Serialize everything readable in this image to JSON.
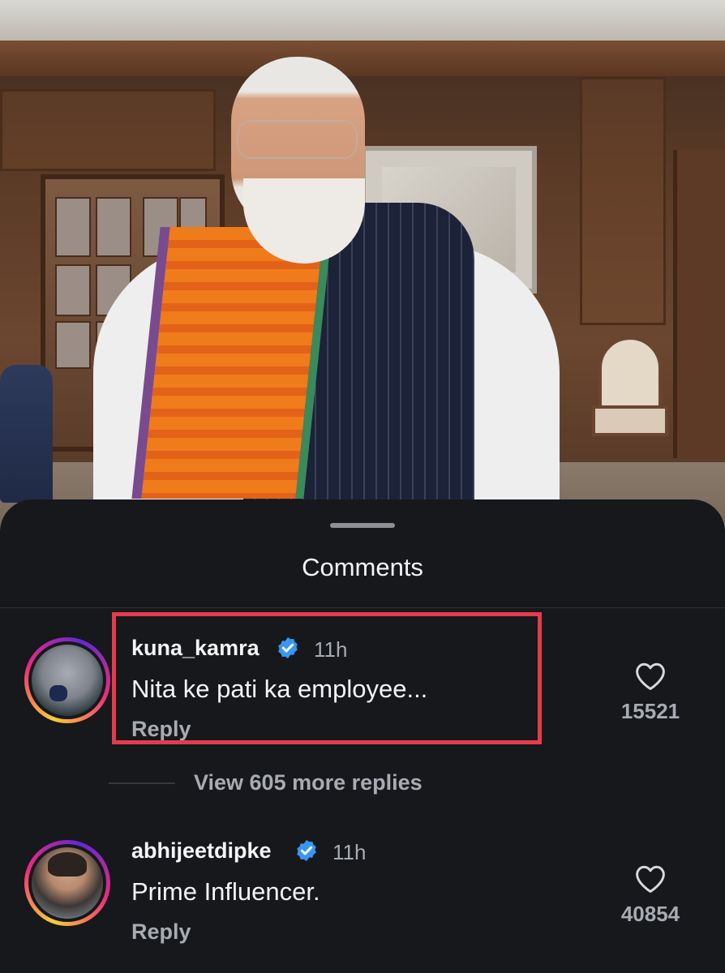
{
  "sheet": {
    "title": "Comments"
  },
  "comments": [
    {
      "username": "kuna_kamra",
      "verified": true,
      "time": "11h",
      "text": "Nita ke pati ka employee...",
      "reply_label": "Reply",
      "like_count": "15521",
      "highlighted": true
    },
    {
      "username": "abhijeetdipke",
      "verified": true,
      "time": "11h",
      "text": "Prime Influencer.",
      "reply_label": "Reply",
      "like_count": "40854",
      "highlighted": false
    }
  ],
  "replies": {
    "view_more_label": "View 605 more replies"
  },
  "colors": {
    "highlight_border": "#e63b4d",
    "verified_badge": "#3897f0",
    "background": "#16181b"
  },
  "icons": [
    "verified-badge-icon",
    "heart-icon"
  ]
}
